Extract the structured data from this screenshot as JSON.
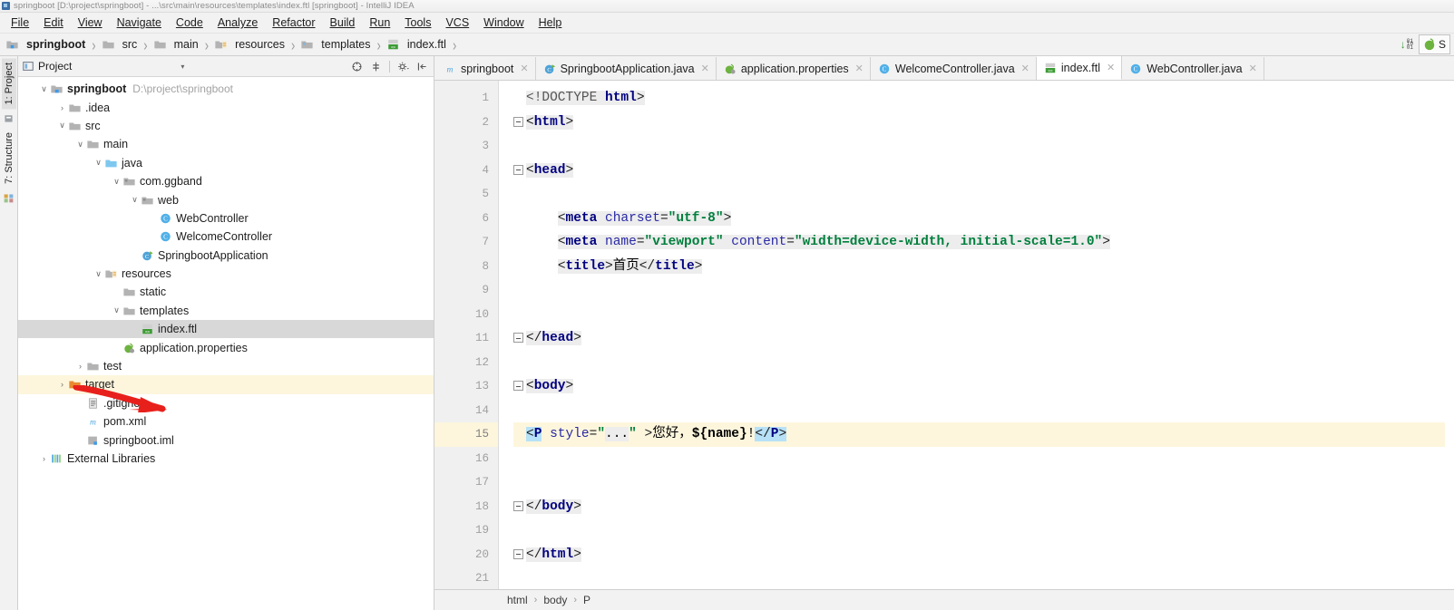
{
  "window": {
    "title": "springboot [D:\\project\\springboot] - ...\\src\\main\\resources\\templates\\index.ftl [springboot] - IntelliJ IDEA",
    "icon": "intellij-idea-icon"
  },
  "menubar": {
    "items": [
      {
        "label": "File",
        "mnemonic": "F"
      },
      {
        "label": "Edit",
        "mnemonic": "E"
      },
      {
        "label": "View",
        "mnemonic": "V"
      },
      {
        "label": "Navigate",
        "mnemonic": "N"
      },
      {
        "label": "Code",
        "mnemonic": "C"
      },
      {
        "label": "Analyze",
        "mnemonic": "y"
      },
      {
        "label": "Refactor",
        "mnemonic": "R"
      },
      {
        "label": "Build",
        "mnemonic": "B"
      },
      {
        "label": "Run",
        "mnemonic": "u"
      },
      {
        "label": "Tools",
        "mnemonic": "T"
      },
      {
        "label": "VCS",
        "mnemonic": "S"
      },
      {
        "label": "Window",
        "mnemonic": "W"
      },
      {
        "label": "Help",
        "mnemonic": "H"
      }
    ]
  },
  "navbar": {
    "crumbs": [
      {
        "label": "springboot",
        "icon": "module-icon",
        "bold": true
      },
      {
        "label": "src",
        "icon": "folder-icon",
        "bold": false
      },
      {
        "label": "main",
        "icon": "folder-icon",
        "bold": false
      },
      {
        "label": "resources",
        "icon": "resources-folder-icon",
        "bold": false
      },
      {
        "label": "templates",
        "icon": "folder-icon",
        "bold": false
      },
      {
        "label": "index.ftl",
        "icon": "ftl-file-icon",
        "bold": false
      }
    ],
    "separator": "›",
    "right": {
      "update_icon": "version-update-icon",
      "update_digits": [
        "01",
        "10",
        "01"
      ],
      "server_chip_label": "S",
      "server_chip_icon": "spring-boot-icon"
    }
  },
  "toolstrip": {
    "tabs": [
      {
        "label": "1: Project",
        "active": true
      },
      {
        "label": "7: Structure",
        "active": false
      }
    ],
    "icons": [
      "favorites-icon",
      "ant-build-icon"
    ]
  },
  "project_panel": {
    "header": {
      "icon": "project-view-icon",
      "title": "Project",
      "caret": "▾",
      "actions": [
        {
          "name": "collapse-all-icon"
        },
        {
          "name": "expand-all-icon"
        },
        {
          "name": "settings-gear-icon"
        },
        {
          "name": "hide-panel-icon"
        }
      ]
    },
    "tree": [
      {
        "indent": 0,
        "twist": "v",
        "icon": "module-icon",
        "label": "springboot",
        "bold": true,
        "path": "D:\\project\\springboot",
        "state": "normal"
      },
      {
        "indent": 1,
        "twist": ">",
        "icon": "folder-icon",
        "label": ".idea",
        "bold": false,
        "path": "",
        "state": "normal"
      },
      {
        "indent": 1,
        "twist": "v",
        "icon": "folder-icon",
        "label": "src",
        "bold": false,
        "path": "",
        "state": "normal"
      },
      {
        "indent": 2,
        "twist": "v",
        "icon": "folder-icon",
        "label": "main",
        "bold": false,
        "path": "",
        "state": "normal"
      },
      {
        "indent": 3,
        "twist": "v",
        "icon": "source-folder-icon",
        "label": "java",
        "bold": false,
        "path": "",
        "state": "normal"
      },
      {
        "indent": 4,
        "twist": "v",
        "icon": "package-icon",
        "label": "com.ggband",
        "bold": false,
        "path": "",
        "state": "normal"
      },
      {
        "indent": 5,
        "twist": "v",
        "icon": "package-icon",
        "label": "web",
        "bold": false,
        "path": "",
        "state": "normal"
      },
      {
        "indent": 6,
        "twist": "",
        "icon": "java-class-icon",
        "label": "WebController",
        "bold": false,
        "path": "",
        "state": "normal"
      },
      {
        "indent": 6,
        "twist": "",
        "icon": "java-class-icon",
        "label": "WelcomeController",
        "bold": false,
        "path": "",
        "state": "normal"
      },
      {
        "indent": 5,
        "twist": "",
        "icon": "spring-boot-class-icon",
        "label": "SpringbootApplication",
        "bold": false,
        "path": "",
        "state": "normal"
      },
      {
        "indent": 3,
        "twist": "v",
        "icon": "resources-folder-icon",
        "label": "resources",
        "bold": false,
        "path": "",
        "state": "normal"
      },
      {
        "indent": 4,
        "twist": "",
        "icon": "folder-icon",
        "label": "static",
        "bold": false,
        "path": "",
        "state": "normal"
      },
      {
        "indent": 4,
        "twist": "v",
        "icon": "folder-icon",
        "label": "templates",
        "bold": false,
        "path": "",
        "state": "normal"
      },
      {
        "indent": 5,
        "twist": "",
        "icon": "ftl-file-icon",
        "label": "index.ftl",
        "bold": false,
        "path": "",
        "state": "selected"
      },
      {
        "indent": 4,
        "twist": "",
        "icon": "properties-file-icon",
        "label": "application.properties",
        "bold": false,
        "path": "",
        "state": "normal"
      },
      {
        "indent": 2,
        "twist": ">",
        "icon": "folder-icon",
        "label": "test",
        "bold": false,
        "path": "",
        "state": "normal"
      },
      {
        "indent": 1,
        "twist": ">",
        "icon": "excluded-folder-icon",
        "label": "target",
        "bold": false,
        "path": "",
        "state": "marked"
      },
      {
        "indent": 2,
        "twist": "",
        "icon": "gitignore-file-icon",
        "label": ".gitignore",
        "bold": false,
        "path": "",
        "state": "normal"
      },
      {
        "indent": 2,
        "twist": "",
        "icon": "maven-pom-icon",
        "label": "pom.xml",
        "bold": false,
        "path": "",
        "state": "normal"
      },
      {
        "indent": 2,
        "twist": "",
        "icon": "iml-file-icon",
        "label": "springboot.iml",
        "bold": false,
        "path": "",
        "state": "normal"
      },
      {
        "indent": 0,
        "twist": ">",
        "icon": "external-libraries-icon",
        "label": "External Libraries",
        "bold": false,
        "path": "",
        "state": "normal"
      }
    ],
    "annotation": {
      "name": "red-arrow-annotation",
      "points_to": "index.ftl",
      "color": "#e8201c"
    }
  },
  "editor": {
    "tabs": [
      {
        "label": "springboot",
        "icon": "maven-module-icon",
        "active": false,
        "closable": true
      },
      {
        "label": "SpringbootApplication.java",
        "icon": "spring-boot-class-icon",
        "active": false,
        "closable": true
      },
      {
        "label": "application.properties",
        "icon": "properties-file-icon",
        "active": false,
        "closable": true
      },
      {
        "label": "WelcomeController.java",
        "icon": "java-class-icon",
        "active": false,
        "closable": true
      },
      {
        "label": "index.ftl",
        "icon": "ftl-file-icon",
        "active": true,
        "closable": true
      },
      {
        "label": "WebController.java",
        "icon": "java-class-icon",
        "active": false,
        "closable": true
      }
    ],
    "close_glyph": "✕",
    "current_line": 15,
    "lines": [
      {
        "n": 1,
        "fold": "",
        "tokens": [
          {
            "t": "<!DOCTYPE ",
            "c": "tk-doctype",
            "bg": true
          },
          {
            "t": "html",
            "c": "tk-tag",
            "bg": true
          },
          {
            "t": ">",
            "c": "tk-punct",
            "bg": true
          }
        ]
      },
      {
        "n": 2,
        "fold": "open",
        "tokens": [
          {
            "t": "<",
            "c": "tk-punct",
            "bg": true
          },
          {
            "t": "html",
            "c": "tk-tag",
            "bg": true
          },
          {
            "t": ">",
            "c": "tk-punct",
            "bg": true
          }
        ]
      },
      {
        "n": 3,
        "fold": "",
        "tokens": []
      },
      {
        "n": 4,
        "fold": "open",
        "tokens": [
          {
            "t": "<",
            "c": "tk-punct",
            "bg": true
          },
          {
            "t": "head",
            "c": "tk-tag",
            "bg": true
          },
          {
            "t": ">",
            "c": "tk-punct",
            "bg": true
          }
        ]
      },
      {
        "n": 5,
        "fold": "",
        "tokens": []
      },
      {
        "n": 6,
        "fold": "",
        "tokens": [
          {
            "t": "    ",
            "c": "tk-plain",
            "bg": false
          },
          {
            "t": "<",
            "c": "tk-punct",
            "bg": true
          },
          {
            "t": "meta ",
            "c": "tk-tag",
            "bg": true
          },
          {
            "t": "charset",
            "c": "tk-attr",
            "bg": true
          },
          {
            "t": "=",
            "c": "tk-punct",
            "bg": true
          },
          {
            "t": "\"utf-8\"",
            "c": "tk-str",
            "bg": true
          },
          {
            "t": ">",
            "c": "tk-punct",
            "bg": true
          }
        ]
      },
      {
        "n": 7,
        "fold": "",
        "tokens": [
          {
            "t": "    ",
            "c": "tk-plain",
            "bg": false
          },
          {
            "t": "<",
            "c": "tk-punct",
            "bg": true
          },
          {
            "t": "meta ",
            "c": "tk-tag",
            "bg": true
          },
          {
            "t": "name",
            "c": "tk-attr",
            "bg": true
          },
          {
            "t": "=",
            "c": "tk-punct",
            "bg": true
          },
          {
            "t": "\"viewport\"",
            "c": "tk-str",
            "bg": true
          },
          {
            "t": " ",
            "c": "tk-plain",
            "bg": true
          },
          {
            "t": "content",
            "c": "tk-attr",
            "bg": true
          },
          {
            "t": "=",
            "c": "tk-punct",
            "bg": true
          },
          {
            "t": "\"width=device-width, initial-scale=1.0\"",
            "c": "tk-str",
            "bg": true
          },
          {
            "t": ">",
            "c": "tk-punct",
            "bg": true
          }
        ]
      },
      {
        "n": 8,
        "fold": "",
        "tokens": [
          {
            "t": "    ",
            "c": "tk-plain",
            "bg": false
          },
          {
            "t": "<",
            "c": "tk-punct",
            "bg": true
          },
          {
            "t": "title",
            "c": "tk-tag",
            "bg": true
          },
          {
            "t": ">",
            "c": "tk-punct",
            "bg": true
          },
          {
            "t": "首页",
            "c": "tk-plain",
            "bg": true
          },
          {
            "t": "</",
            "c": "tk-punct",
            "bg": true
          },
          {
            "t": "title",
            "c": "tk-tag",
            "bg": true
          },
          {
            "t": ">",
            "c": "tk-punct",
            "bg": true
          }
        ]
      },
      {
        "n": 9,
        "fold": "",
        "tokens": []
      },
      {
        "n": 10,
        "fold": "",
        "tokens": []
      },
      {
        "n": 11,
        "fold": "open",
        "tokens": [
          {
            "t": "</",
            "c": "tk-punct",
            "bg": true
          },
          {
            "t": "head",
            "c": "tk-tag",
            "bg": true
          },
          {
            "t": ">",
            "c": "tk-punct",
            "bg": true
          }
        ]
      },
      {
        "n": 12,
        "fold": "",
        "tokens": []
      },
      {
        "n": 13,
        "fold": "open",
        "tokens": [
          {
            "t": "<",
            "c": "tk-punct",
            "bg": true
          },
          {
            "t": "body",
            "c": "tk-tag",
            "bg": true
          },
          {
            "t": ">",
            "c": "tk-punct",
            "bg": true
          }
        ]
      },
      {
        "n": 14,
        "fold": "",
        "tokens": []
      },
      {
        "n": 15,
        "fold": "",
        "tokens": [
          {
            "t": "<",
            "c": "tk-punct matched",
            "bg": false
          },
          {
            "t": "P",
            "c": "tk-tag matched",
            "bg": false
          },
          {
            "t": " ",
            "c": "tk-plain",
            "bg": false
          },
          {
            "t": "style",
            "c": "tk-attr",
            "bg": false
          },
          {
            "t": "=",
            "c": "tk-punct",
            "bg": false
          },
          {
            "t": "\"",
            "c": "tk-str",
            "bg": false
          },
          {
            "t": "...",
            "c": "tk-plain",
            "bg": true
          },
          {
            "t": "\"",
            "c": "tk-str",
            "bg": false
          },
          {
            "t": " >",
            "c": "tk-punct",
            "bg": false
          },
          {
            "t": "您好，",
            "c": "tk-plain",
            "bg": false
          },
          {
            "t": "${name}",
            "c": "tk-var",
            "bg": false
          },
          {
            "t": "!",
            "c": "tk-plain",
            "bg": false
          },
          {
            "t": "</",
            "c": "tk-punct matched",
            "bg": false
          },
          {
            "t": "P",
            "c": "tk-tag matched",
            "bg": false
          },
          {
            "t": ">",
            "c": "tk-punct matched",
            "bg": false
          }
        ]
      },
      {
        "n": 16,
        "fold": "",
        "tokens": []
      },
      {
        "n": 17,
        "fold": "",
        "tokens": []
      },
      {
        "n": 18,
        "fold": "open",
        "tokens": [
          {
            "t": "</",
            "c": "tk-punct",
            "bg": true
          },
          {
            "t": "body",
            "c": "tk-tag",
            "bg": true
          },
          {
            "t": ">",
            "c": "tk-punct",
            "bg": true
          }
        ]
      },
      {
        "n": 19,
        "fold": "",
        "tokens": []
      },
      {
        "n": 20,
        "fold": "open",
        "tokens": [
          {
            "t": "</",
            "c": "tk-punct",
            "bg": true
          },
          {
            "t": "html",
            "c": "tk-tag",
            "bg": true
          },
          {
            "t": ">",
            "c": "tk-punct",
            "bg": true
          }
        ]
      },
      {
        "n": 21,
        "fold": "",
        "tokens": []
      }
    ]
  },
  "bottom_breadcrumb": {
    "items": [
      "html",
      "body",
      "P"
    ],
    "separator": "›"
  },
  "colors": {
    "tag": "#000080",
    "attribute": "#2a2aa5",
    "string": "#007f3d",
    "current_line_bg": "#fdf6dd",
    "selection_bg": "#d8d8d8",
    "matched_tag_bg": "#b7e1f7",
    "annotation_red": "#e8201c"
  }
}
